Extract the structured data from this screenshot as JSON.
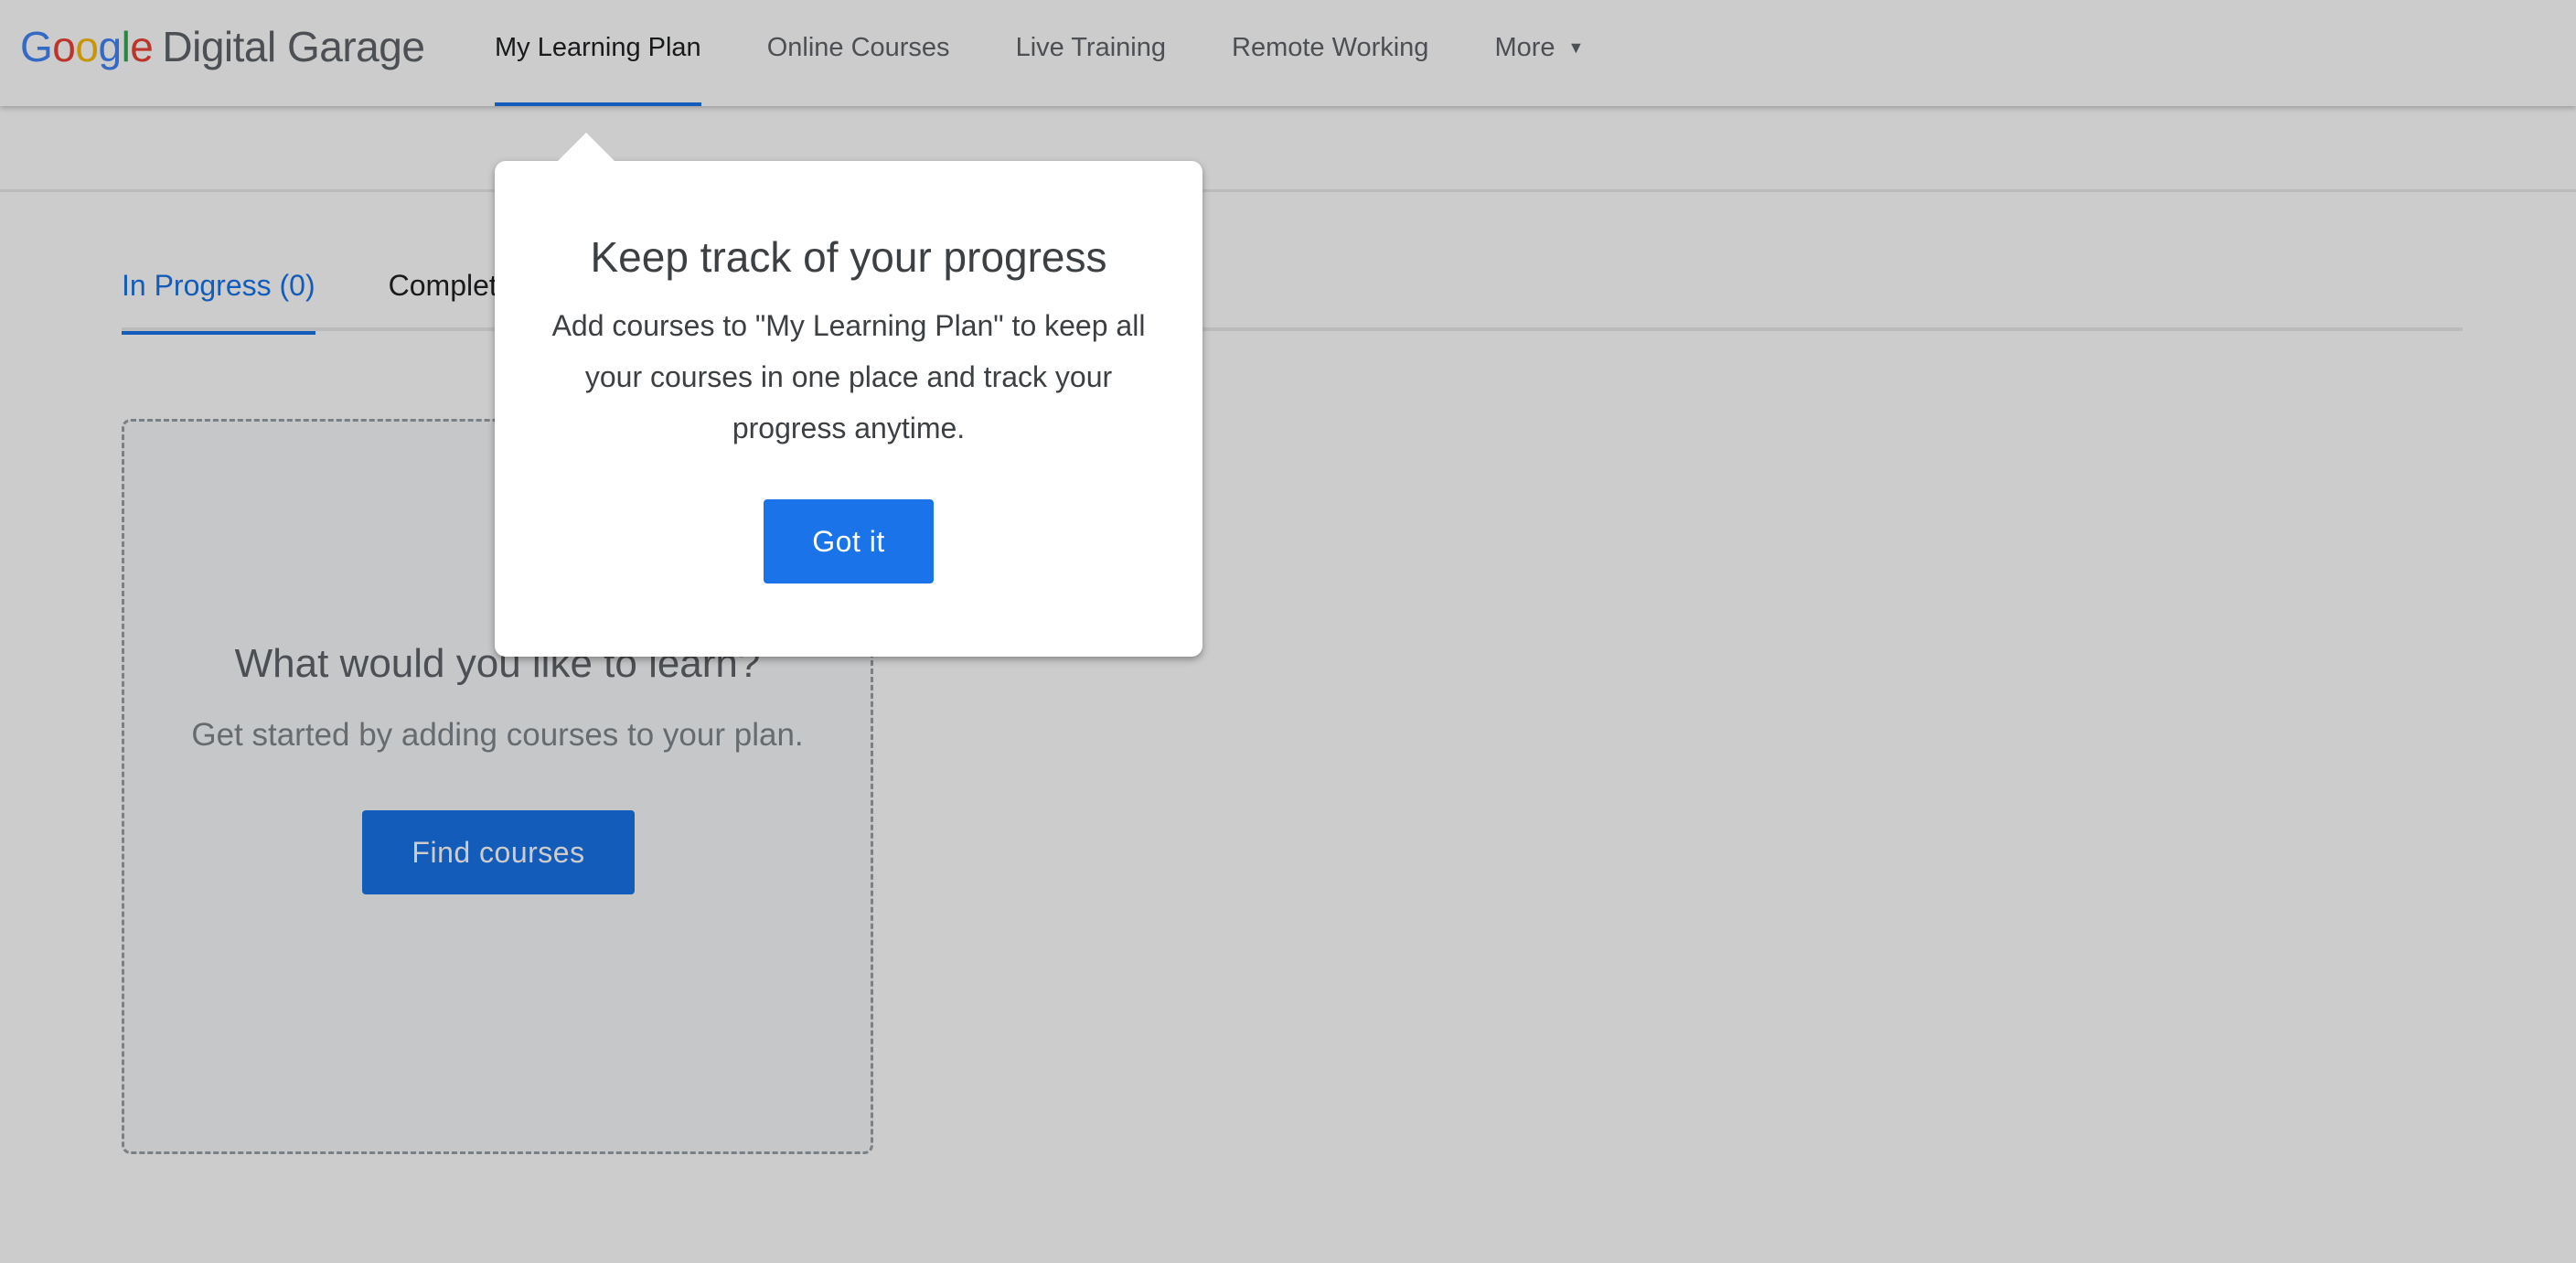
{
  "header": {
    "logo": {
      "google_letters": [
        {
          "char": "G",
          "color": "#4285f4"
        },
        {
          "char": "o",
          "color": "#ea4335"
        },
        {
          "char": "o",
          "color": "#fbbc05"
        },
        {
          "char": "g",
          "color": "#4285f4"
        },
        {
          "char": "l",
          "color": "#34a853"
        },
        {
          "char": "e",
          "color": "#ea4335"
        }
      ],
      "product_name": "Digital Garage"
    },
    "nav": [
      {
        "label": "My Learning Plan",
        "active": true
      },
      {
        "label": "Online Courses",
        "active": false
      },
      {
        "label": "Live Training",
        "active": false
      },
      {
        "label": "Remote Working",
        "active": false
      },
      {
        "label": "More",
        "active": false,
        "icon": "caret-down-icon",
        "glyph": "▼"
      }
    ]
  },
  "tabs": [
    {
      "label": "In Progress (0)",
      "active": true
    },
    {
      "label": "Completed",
      "active": false
    }
  ],
  "empty_state": {
    "title": "What would you like to learn?",
    "subtitle": "Get started by adding courses to your plan.",
    "button_label": "Find courses"
  },
  "popup": {
    "title": "Keep track of your progress",
    "body": "Add courses to \"My Learning Plan\" to keep all your courses in one place and track your progress anytime.",
    "button_label": "Got it"
  },
  "colors": {
    "accent": "#1a73e8",
    "text_primary": "#202124",
    "text_secondary": "#5f6368"
  }
}
